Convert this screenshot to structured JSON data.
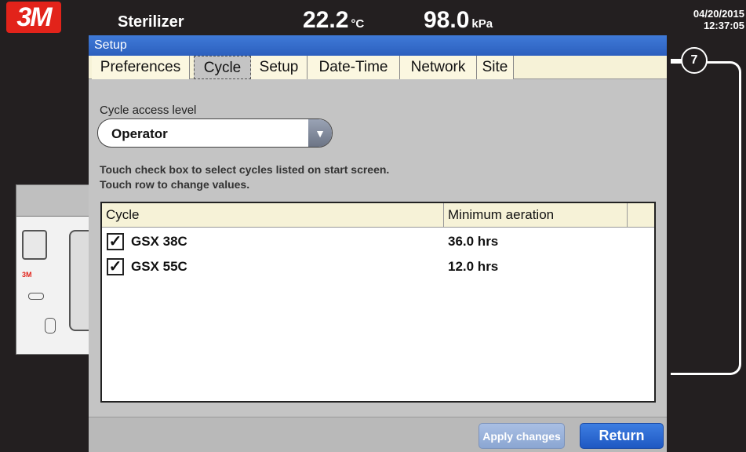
{
  "header": {
    "logo_text": "3M",
    "title": "Sterilizer",
    "temperature": "22.2",
    "temperature_unit": "°C",
    "pressure": "98.0",
    "pressure_unit": "kPa",
    "date": "04/20/2015",
    "time": "12:37:05"
  },
  "device": {
    "badge": "3M"
  },
  "callout": {
    "number": "7"
  },
  "window": {
    "title": "Setup",
    "tabs": [
      {
        "label": "Preferences"
      },
      {
        "label": "Cycle"
      },
      {
        "label": "Setup"
      },
      {
        "label": "Date-Time"
      },
      {
        "label": "Network"
      },
      {
        "label": "Site"
      }
    ],
    "active_tab": "Cycle"
  },
  "cycle_tab": {
    "access_label": "Cycle access level",
    "access_value": "Operator",
    "instructions_line1": "Touch check box to select cycles listed on start screen.",
    "instructions_line2": "Touch row to change values.",
    "table": {
      "columns": [
        "Cycle",
        "Minimum aeration"
      ],
      "rows": [
        {
          "checked": true,
          "name": "GSX 38C",
          "aeration": "36.0 hrs"
        },
        {
          "checked": true,
          "name": "GSX 55C",
          "aeration": "12.0 hrs"
        }
      ]
    }
  },
  "footer": {
    "apply_label": "Apply changes",
    "return_label": "Return"
  },
  "colors": {
    "brand_red": "#e2231a",
    "title_bar_blue": "#2c5fbe",
    "return_button_blue": "#1f58c2",
    "tab_background": "#f6f2d7",
    "panel_gray": "#c4c4c4"
  }
}
